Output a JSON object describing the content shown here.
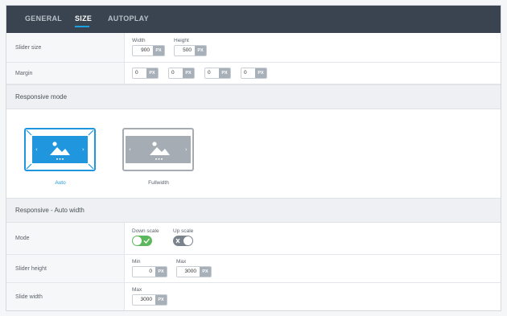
{
  "tabs": [
    {
      "label": "GENERAL"
    },
    {
      "label": "SIZE"
    },
    {
      "label": "AUTOPLAY"
    }
  ],
  "slider_size": {
    "label": "Slider size",
    "width_caption": "Width",
    "width_value": "900",
    "height_caption": "Height",
    "height_value": "500",
    "unit": "PX"
  },
  "margin": {
    "label": "Margin",
    "values": [
      "0",
      "0",
      "0",
      "0"
    ],
    "unit": "PX"
  },
  "responsive_mode": {
    "title": "Responsive mode",
    "options": [
      {
        "label": "Auto",
        "selected": true
      },
      {
        "label": "Fullwidth",
        "selected": false
      }
    ],
    "accent": "#1f96de"
  },
  "auto_width": {
    "title": "Responsive - Auto width",
    "mode": {
      "label": "Mode",
      "down_scale_caption": "Down scale",
      "down_scale_on": true,
      "up_scale_caption": "Up scale",
      "up_scale_on": false
    },
    "slider_height": {
      "label": "Slider height",
      "min_caption": "Min",
      "min_value": "0",
      "max_caption": "Max",
      "max_value": "3000",
      "unit": "PX"
    },
    "slide_width": {
      "label": "Slide width",
      "max_caption": "Max",
      "max_value": "3000",
      "unit": "PX"
    }
  },
  "colors": {
    "toggle_on": "#5cb85c",
    "toggle_off": "#7a838c",
    "header_bg": "#3a4450"
  }
}
